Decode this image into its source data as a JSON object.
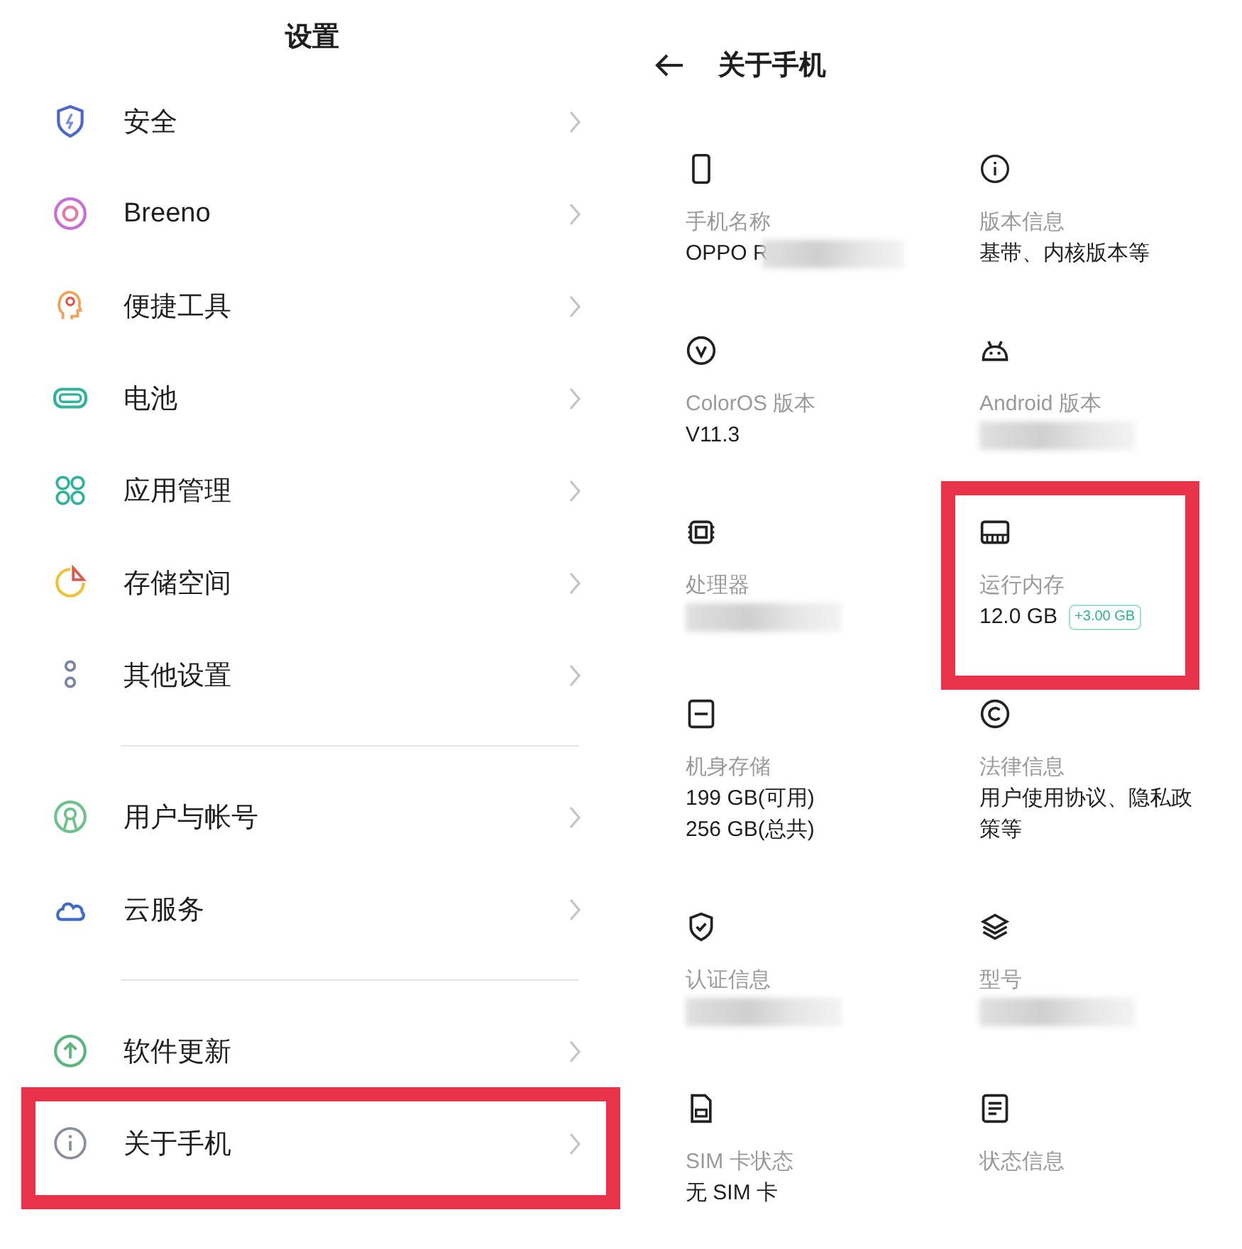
{
  "settings": {
    "title": "设置",
    "groups": [
      [
        {
          "label": "安全",
          "kind": "shield",
          "highlighted": false
        },
        {
          "label": "Breeno",
          "kind": "breeno",
          "highlighted": false
        },
        {
          "label": "便捷工具",
          "kind": "head",
          "highlighted": false
        },
        {
          "label": "电池",
          "kind": "battery",
          "highlighted": false
        },
        {
          "label": "应用管理",
          "kind": "apps",
          "highlighted": false
        },
        {
          "label": "存储空间",
          "kind": "pie",
          "highlighted": false
        },
        {
          "label": "其他设置",
          "kind": "dots",
          "highlighted": false
        }
      ],
      [
        {
          "label": "用户与帐号",
          "kind": "user",
          "highlighted": false
        },
        {
          "label": "云服务",
          "kind": "cloud",
          "highlighted": false
        }
      ],
      [
        {
          "label": "软件更新",
          "kind": "update",
          "highlighted": false
        },
        {
          "label": "关于手机",
          "kind": "info",
          "highlighted": true
        }
      ]
    ]
  },
  "about": {
    "title": "关于手机",
    "items": [
      {
        "kind": "phone",
        "label": "手机名称",
        "value": "OPPO R",
        "redacted": true,
        "highlighted": false
      },
      {
        "kind": "info",
        "label": "版本信息",
        "value": "基带、内核版本等",
        "redacted": false,
        "highlighted": false
      },
      {
        "kind": "v",
        "label": "ColorOS 版本",
        "value": "V11.3",
        "redacted": false,
        "highlighted": false
      },
      {
        "kind": "android",
        "label": "Android 版本",
        "redacted": true,
        "highlighted": false
      },
      {
        "kind": "chip",
        "label": "处理器",
        "redacted": true,
        "highlighted": false
      },
      {
        "kind": "ram",
        "label": "运行内存",
        "value": "12.0 GB",
        "badge": "+3.00 GB",
        "redacted": false,
        "highlighted": true
      },
      {
        "kind": "storage",
        "label": "机身存储",
        "value": "199 GB(可用)\n256 GB(总共)",
        "redacted": false,
        "highlighted": false
      },
      {
        "kind": "copyright",
        "label": "法律信息",
        "value": "用户使用协议、隐私政策等",
        "redacted": false,
        "highlighted": false
      },
      {
        "kind": "shieldcheck",
        "label": "认证信息",
        "redacted": true,
        "highlighted": false
      },
      {
        "kind": "layers",
        "label": "型号",
        "redacted": true,
        "highlighted": false
      },
      {
        "kind": "sim",
        "label": "SIM 卡状态",
        "value": "无 SIM 卡",
        "redacted": false,
        "highlighted": false
      },
      {
        "kind": "doc",
        "label": "状态信息",
        "redacted": false,
        "highlighted": false
      }
    ]
  }
}
